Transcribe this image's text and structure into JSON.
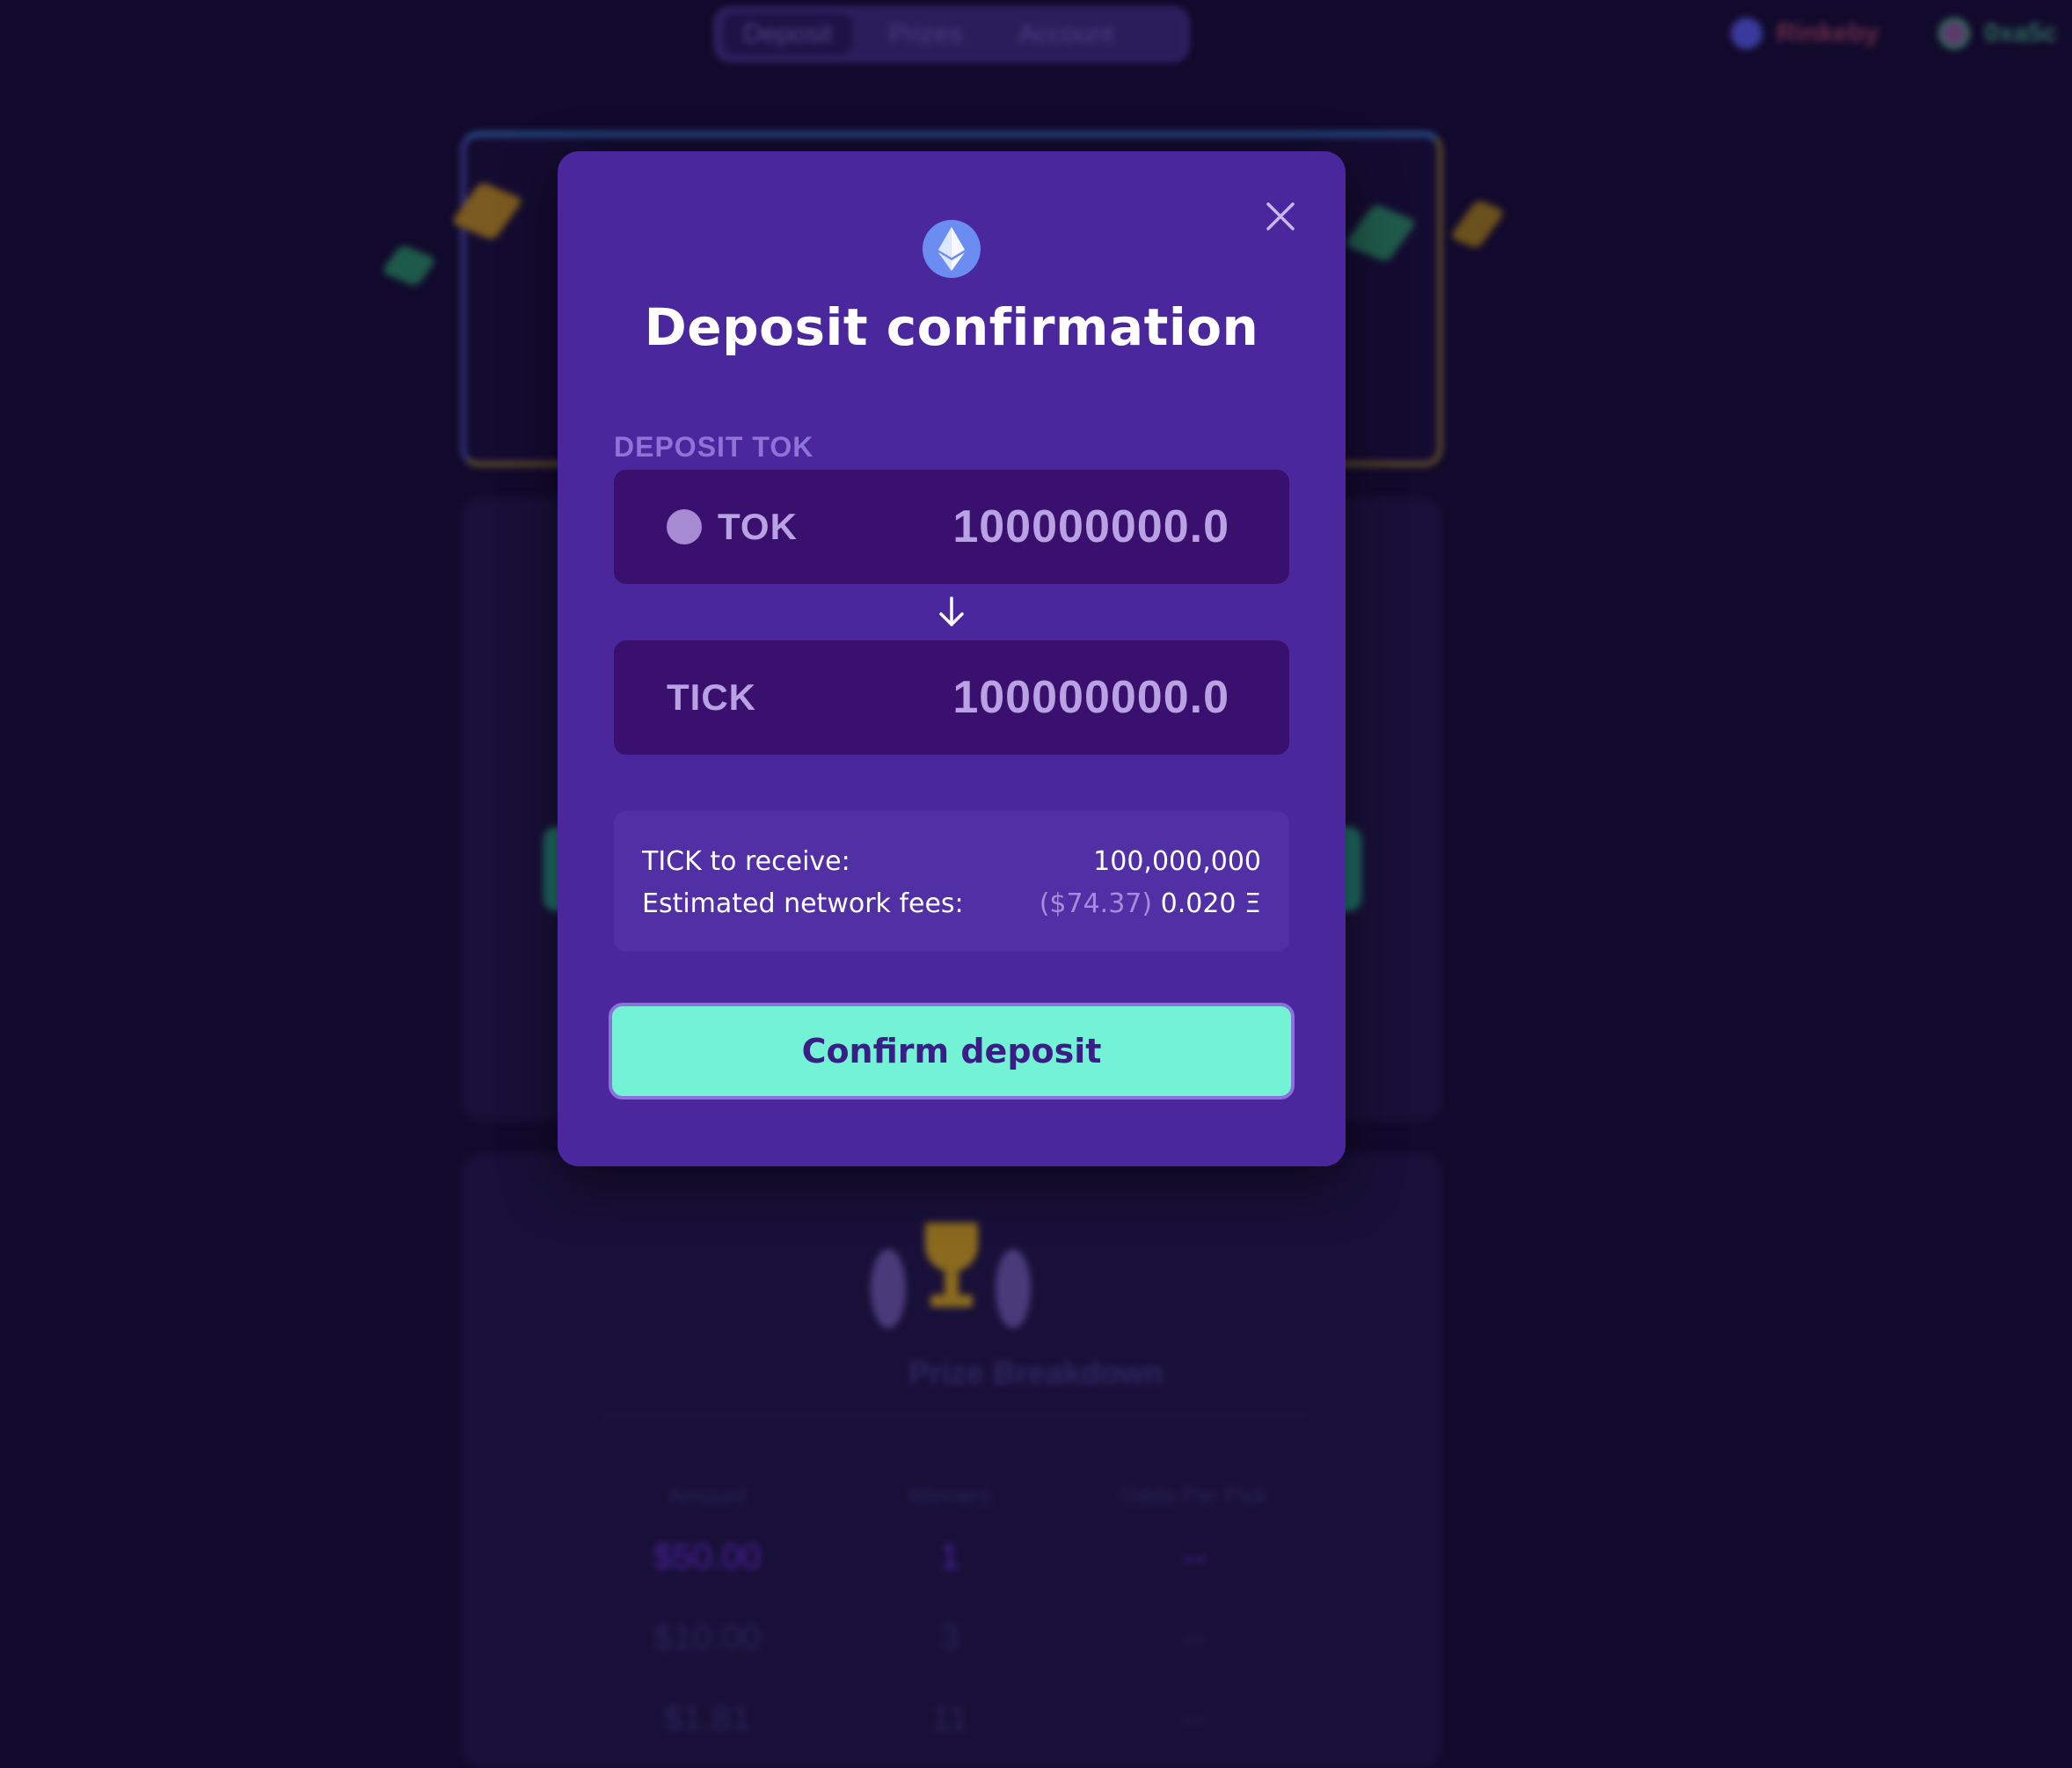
{
  "nav": {
    "tabs": [
      {
        "label": "Deposit"
      },
      {
        "label": "Prizes"
      },
      {
        "label": "Account"
      }
    ],
    "network": "Rinkeby",
    "wallet": "0xa5c"
  },
  "prize_breakdown": {
    "title": "Prize Breakdown",
    "headers": [
      "Amount",
      "Winners",
      "Odds Per Pick"
    ],
    "rows": [
      {
        "amount": "$50.00",
        "winners": "1",
        "odds": "--"
      },
      {
        "amount": "$10.00",
        "winners": "3",
        "odds": "--"
      },
      {
        "amount": "$1.81",
        "winners": "11",
        "odds": "--"
      }
    ]
  },
  "modal": {
    "title": "Deposit confirmation",
    "section_label": "DEPOSIT TOK",
    "from": {
      "symbol": "TOK",
      "amount": "100000000.0"
    },
    "to": {
      "symbol": "TICK",
      "amount": "100000000.0"
    },
    "summary": {
      "receive_label": "TICK to receive:",
      "receive_value": "100,000,000",
      "fees_label": "Estimated network fees:",
      "fees_usd": "($74.37)",
      "fees_eth": "0.020 Ξ"
    },
    "confirm_label": "Confirm deposit"
  },
  "colors": {
    "page_bg": "#120a2c",
    "modal_bg": "#4a279c",
    "token_box_bg": "#3a106e",
    "accent_teal": "#74f2d6",
    "button_text": "#3a1d86"
  },
  "icons": {
    "modal_header": "ethereum-icon",
    "close": "close-icon",
    "token": "token-circle-icon",
    "flow": "arrow-down-icon"
  }
}
